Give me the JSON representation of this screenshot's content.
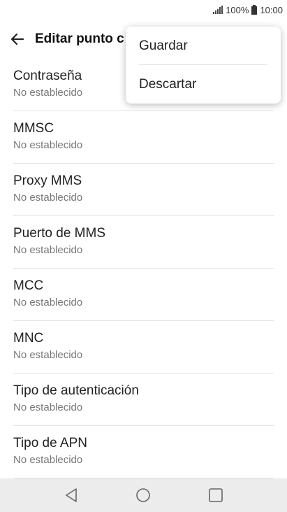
{
  "status_bar": {
    "battery_percent": "100%",
    "time": "10:00"
  },
  "app_bar": {
    "title": "Editar punto c"
  },
  "menu": {
    "items": [
      "Guardar",
      "Descartar"
    ]
  },
  "settings": [
    {
      "title": "Contraseña",
      "value": "No establecido"
    },
    {
      "title": "MMSC",
      "value": "No establecido"
    },
    {
      "title": "Proxy MMS",
      "value": "No establecido"
    },
    {
      "title": "Puerto de MMS",
      "value": "No establecido"
    },
    {
      "title": "MCC",
      "value": "No establecido"
    },
    {
      "title": "MNC",
      "value": "No establecido"
    },
    {
      "title": "Tipo de autenticación",
      "value": "No establecido"
    },
    {
      "title": "Tipo de APN",
      "value": "No establecido"
    }
  ],
  "icons": {
    "back": "back-arrow-icon",
    "nav_back": "triangle-back-icon",
    "nav_home": "circle-home-icon",
    "nav_recents": "square-recents-icon"
  }
}
